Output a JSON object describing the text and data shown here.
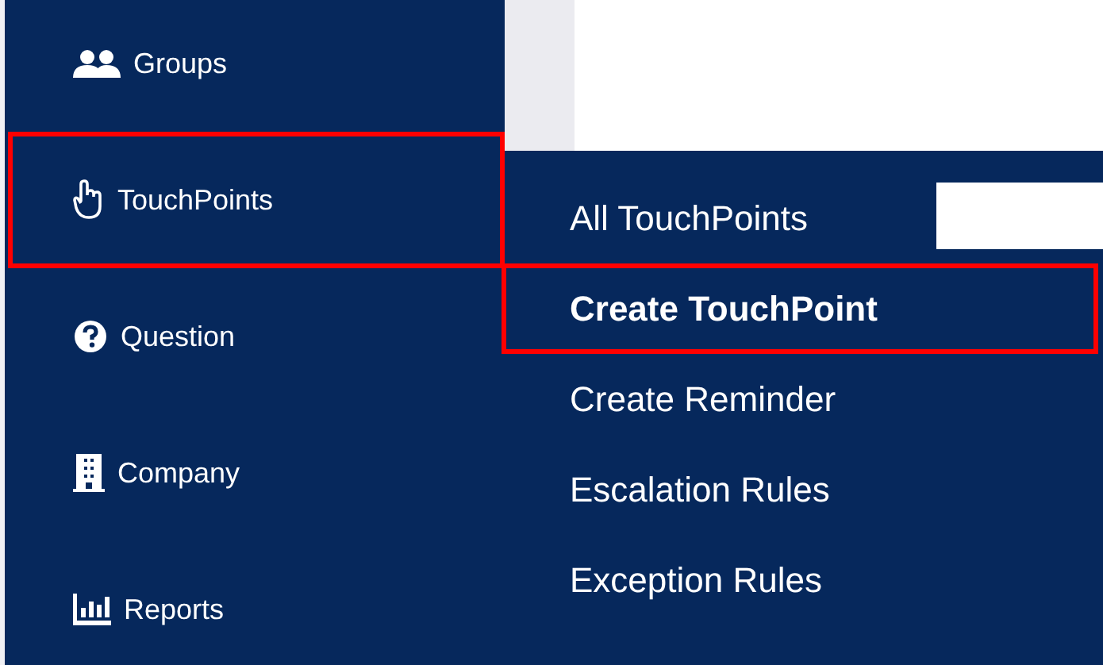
{
  "sidebar": {
    "items": [
      {
        "label": "Groups",
        "kind": "users",
        "selected": false
      },
      {
        "label": "TouchPoints",
        "kind": "hand",
        "selected": true
      },
      {
        "label": "Question",
        "kind": "question",
        "selected": false
      },
      {
        "label": "Company",
        "kind": "building",
        "selected": false
      },
      {
        "label": "Reports",
        "kind": "chart",
        "selected": false
      }
    ]
  },
  "submenu": {
    "items": [
      {
        "label": "All TouchPoints",
        "selected": false
      },
      {
        "label": "Create TouchPoint",
        "selected": true
      },
      {
        "label": "Create Reminder",
        "selected": false
      },
      {
        "label": "Escalation Rules",
        "selected": false
      },
      {
        "label": "Exception Rules",
        "selected": false
      }
    ]
  }
}
